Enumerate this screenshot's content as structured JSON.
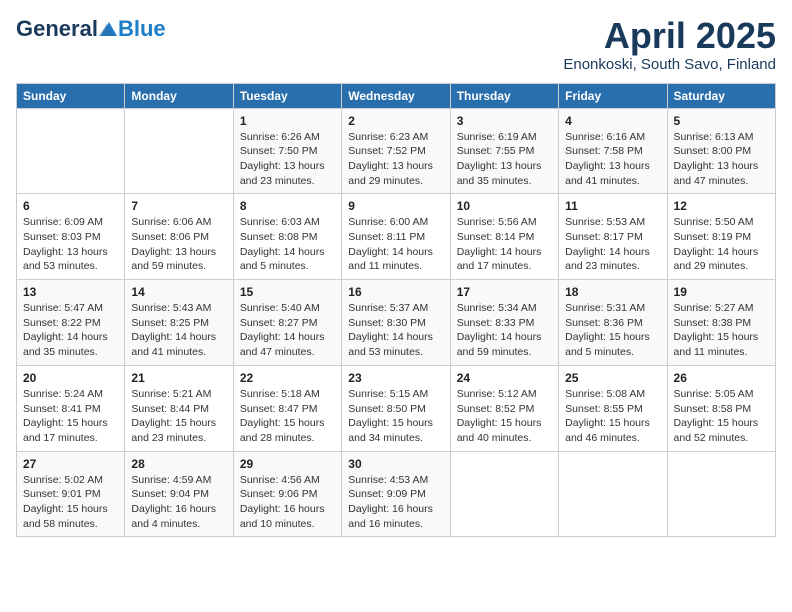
{
  "header": {
    "logo": {
      "general": "General",
      "blue": "Blue"
    },
    "month": "April 2025",
    "location": "Enonkoski, South Savo, Finland"
  },
  "days_of_week": [
    "Sunday",
    "Monday",
    "Tuesday",
    "Wednesday",
    "Thursday",
    "Friday",
    "Saturday"
  ],
  "weeks": [
    [
      {
        "day": "",
        "detail": ""
      },
      {
        "day": "",
        "detail": ""
      },
      {
        "day": "1",
        "detail": "Sunrise: 6:26 AM\nSunset: 7:50 PM\nDaylight: 13 hours\nand 23 minutes."
      },
      {
        "day": "2",
        "detail": "Sunrise: 6:23 AM\nSunset: 7:52 PM\nDaylight: 13 hours\nand 29 minutes."
      },
      {
        "day": "3",
        "detail": "Sunrise: 6:19 AM\nSunset: 7:55 PM\nDaylight: 13 hours\nand 35 minutes."
      },
      {
        "day": "4",
        "detail": "Sunrise: 6:16 AM\nSunset: 7:58 PM\nDaylight: 13 hours\nand 41 minutes."
      },
      {
        "day": "5",
        "detail": "Sunrise: 6:13 AM\nSunset: 8:00 PM\nDaylight: 13 hours\nand 47 minutes."
      }
    ],
    [
      {
        "day": "6",
        "detail": "Sunrise: 6:09 AM\nSunset: 8:03 PM\nDaylight: 13 hours\nand 53 minutes."
      },
      {
        "day": "7",
        "detail": "Sunrise: 6:06 AM\nSunset: 8:06 PM\nDaylight: 13 hours\nand 59 minutes."
      },
      {
        "day": "8",
        "detail": "Sunrise: 6:03 AM\nSunset: 8:08 PM\nDaylight: 14 hours\nand 5 minutes."
      },
      {
        "day": "9",
        "detail": "Sunrise: 6:00 AM\nSunset: 8:11 PM\nDaylight: 14 hours\nand 11 minutes."
      },
      {
        "day": "10",
        "detail": "Sunrise: 5:56 AM\nSunset: 8:14 PM\nDaylight: 14 hours\nand 17 minutes."
      },
      {
        "day": "11",
        "detail": "Sunrise: 5:53 AM\nSunset: 8:17 PM\nDaylight: 14 hours\nand 23 minutes."
      },
      {
        "day": "12",
        "detail": "Sunrise: 5:50 AM\nSunset: 8:19 PM\nDaylight: 14 hours\nand 29 minutes."
      }
    ],
    [
      {
        "day": "13",
        "detail": "Sunrise: 5:47 AM\nSunset: 8:22 PM\nDaylight: 14 hours\nand 35 minutes."
      },
      {
        "day": "14",
        "detail": "Sunrise: 5:43 AM\nSunset: 8:25 PM\nDaylight: 14 hours\nand 41 minutes."
      },
      {
        "day": "15",
        "detail": "Sunrise: 5:40 AM\nSunset: 8:27 PM\nDaylight: 14 hours\nand 47 minutes."
      },
      {
        "day": "16",
        "detail": "Sunrise: 5:37 AM\nSunset: 8:30 PM\nDaylight: 14 hours\nand 53 minutes."
      },
      {
        "day": "17",
        "detail": "Sunrise: 5:34 AM\nSunset: 8:33 PM\nDaylight: 14 hours\nand 59 minutes."
      },
      {
        "day": "18",
        "detail": "Sunrise: 5:31 AM\nSunset: 8:36 PM\nDaylight: 15 hours\nand 5 minutes."
      },
      {
        "day": "19",
        "detail": "Sunrise: 5:27 AM\nSunset: 8:38 PM\nDaylight: 15 hours\nand 11 minutes."
      }
    ],
    [
      {
        "day": "20",
        "detail": "Sunrise: 5:24 AM\nSunset: 8:41 PM\nDaylight: 15 hours\nand 17 minutes."
      },
      {
        "day": "21",
        "detail": "Sunrise: 5:21 AM\nSunset: 8:44 PM\nDaylight: 15 hours\nand 23 minutes."
      },
      {
        "day": "22",
        "detail": "Sunrise: 5:18 AM\nSunset: 8:47 PM\nDaylight: 15 hours\nand 28 minutes."
      },
      {
        "day": "23",
        "detail": "Sunrise: 5:15 AM\nSunset: 8:50 PM\nDaylight: 15 hours\nand 34 minutes."
      },
      {
        "day": "24",
        "detail": "Sunrise: 5:12 AM\nSunset: 8:52 PM\nDaylight: 15 hours\nand 40 minutes."
      },
      {
        "day": "25",
        "detail": "Sunrise: 5:08 AM\nSunset: 8:55 PM\nDaylight: 15 hours\nand 46 minutes."
      },
      {
        "day": "26",
        "detail": "Sunrise: 5:05 AM\nSunset: 8:58 PM\nDaylight: 15 hours\nand 52 minutes."
      }
    ],
    [
      {
        "day": "27",
        "detail": "Sunrise: 5:02 AM\nSunset: 9:01 PM\nDaylight: 15 hours\nand 58 minutes."
      },
      {
        "day": "28",
        "detail": "Sunrise: 4:59 AM\nSunset: 9:04 PM\nDaylight: 16 hours\nand 4 minutes."
      },
      {
        "day": "29",
        "detail": "Sunrise: 4:56 AM\nSunset: 9:06 PM\nDaylight: 16 hours\nand 10 minutes."
      },
      {
        "day": "30",
        "detail": "Sunrise: 4:53 AM\nSunset: 9:09 PM\nDaylight: 16 hours\nand 16 minutes."
      },
      {
        "day": "",
        "detail": ""
      },
      {
        "day": "",
        "detail": ""
      },
      {
        "day": "",
        "detail": ""
      }
    ]
  ]
}
